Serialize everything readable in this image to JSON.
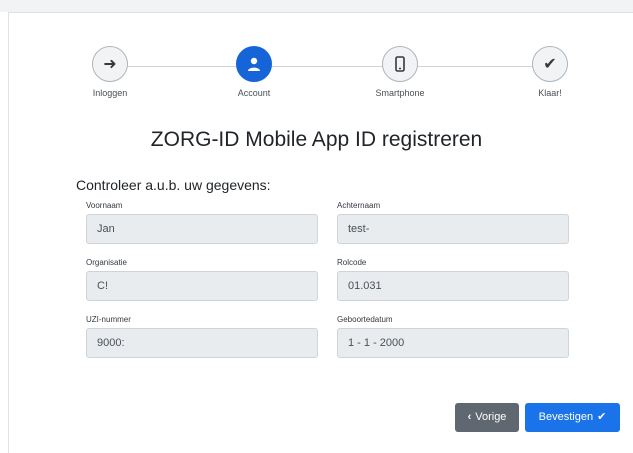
{
  "steps": [
    {
      "label": "Inloggen",
      "icon": "sign-in-icon",
      "glyph": "➜"
    },
    {
      "label": "Account",
      "icon": "user-icon",
      "glyph": "●"
    },
    {
      "label": "Smartphone",
      "icon": "smartphone-icon",
      "glyph": "▯"
    },
    {
      "label": "Klaar!",
      "icon": "check-icon",
      "glyph": "✔"
    }
  ],
  "active_step": 1,
  "title": "ZORG-ID Mobile App ID registreren",
  "subtitle": "Controleer a.u.b. uw gegevens:",
  "fields": {
    "voornaam": {
      "label": "Voornaam",
      "value": "Jan"
    },
    "achternaam": {
      "label": "Achternaam",
      "value": "test-"
    },
    "organisatie": {
      "label": "Organisatie",
      "value": "C!"
    },
    "rolcode": {
      "label": "Rolcode",
      "value": "01.031"
    },
    "uzi": {
      "label": "UZI-nummer",
      "value": "9000:"
    },
    "geboortedatum": {
      "label": "Geboortedatum",
      "value": "1 - 1 - 2000"
    }
  },
  "buttons": {
    "prev_label": "Vorige",
    "prev_icon": "‹",
    "confirm_label": "Bevestigen",
    "confirm_icon": "✔"
  },
  "colors": {
    "primary": "#1a73e8",
    "secondary": "#5f6770",
    "active_step": "#1565d8"
  }
}
